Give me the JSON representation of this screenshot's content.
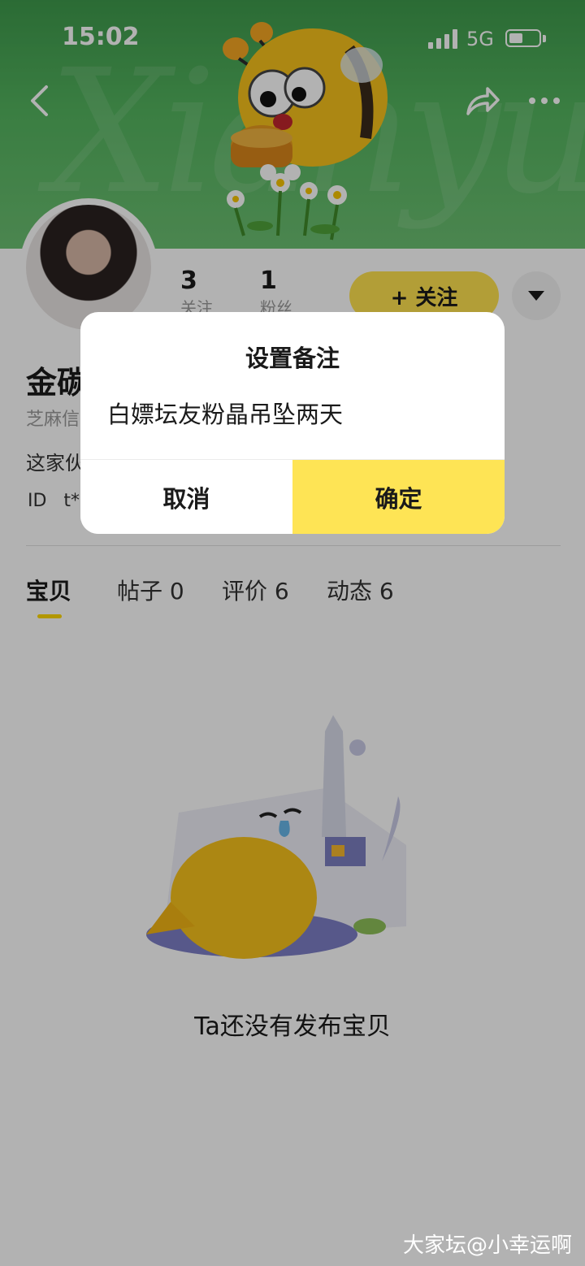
{
  "status_bar": {
    "time": "15:02",
    "network": "5G"
  },
  "banner": {
    "script_text": "Xianyu"
  },
  "profile": {
    "stats": [
      {
        "value": "3",
        "label": "关注"
      },
      {
        "value": "1",
        "label": "粉丝"
      }
    ],
    "follow_label": "+ 关注",
    "name": "金碳",
    "credit": "芝麻信",
    "description": "这家伙",
    "id_prefix": "ID",
    "id_value": "t*"
  },
  "tabs": [
    {
      "label": "宝贝"
    },
    {
      "label": "帖子 0"
    },
    {
      "label": "评价 6"
    },
    {
      "label": "动态 6"
    }
  ],
  "empty_state": {
    "text": "Ta还没有发布宝贝"
  },
  "dialog": {
    "title": "设置备注",
    "input_value": "白嫖坛友粉晶吊坠两天",
    "cancel_label": "取消",
    "confirm_label": "确定"
  },
  "watermark": "大家坛@小幸运啊",
  "colors": {
    "banner_green": "#54b55f",
    "accent_yellow": "#ffe34f",
    "confirm_yellow": "#fee455"
  }
}
